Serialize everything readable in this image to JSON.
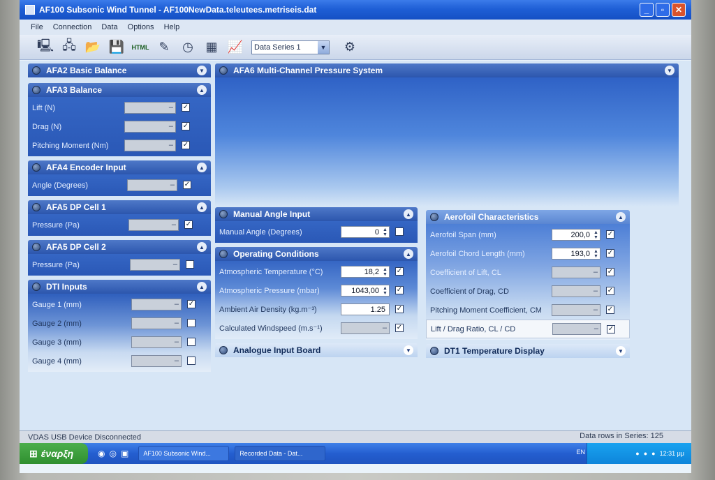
{
  "window": {
    "title": "AF100 Subsonic Wind Tunnel - AF100NewData.teleutees.metriseis.dat"
  },
  "menu": [
    "File",
    "Connection",
    "Data",
    "Options",
    "Help"
  ],
  "toolbar": {
    "icons": [
      "connect-icon",
      "disconnect-icon",
      "open-folder-icon",
      "save-icon",
      "html-icon",
      "pencil-icon",
      "clock-icon",
      "table-icon",
      "chart-icon"
    ],
    "html_label": "HTML",
    "series_select": "Data Series 1"
  },
  "left_panels": {
    "afa2": {
      "title": "AFA2 Basic Balance"
    },
    "afa3": {
      "title": "AFA3 Balance",
      "rows": [
        {
          "label": "Lift  (N)",
          "value": "",
          "checked": true
        },
        {
          "label": "Drag  (N)",
          "value": "",
          "checked": true
        },
        {
          "label": "Pitching Moment  (Nm)",
          "value": "",
          "checked": true
        }
      ]
    },
    "afa4": {
      "title": "AFA4 Encoder Input",
      "rows": [
        {
          "label": "Angle  (Degrees)",
          "value": "",
          "checked": true
        }
      ]
    },
    "afa5_1": {
      "title": "AFA5 DP Cell 1",
      "rows": [
        {
          "label": "Pressure  (Pa)",
          "value": "",
          "checked": true
        }
      ]
    },
    "afa5_2": {
      "title": "AFA5 DP Cell 2",
      "rows": [
        {
          "label": "Pressure  (Pa)",
          "value": "",
          "checked": false
        }
      ]
    },
    "dti": {
      "title": "DTI Inputs",
      "rows": [
        {
          "label": "Gauge 1  (mm)",
          "value": "",
          "checked": true
        },
        {
          "label": "Gauge 2  (mm)",
          "value": "",
          "checked": false
        },
        {
          "label": "Gauge 3  (mm)",
          "value": "",
          "checked": false
        },
        {
          "label": "Gauge 4  (mm)",
          "value": "",
          "checked": false
        }
      ]
    }
  },
  "afa6": {
    "title": "AFA6 Multi-Channel Pressure System"
  },
  "manual_angle": {
    "title": "Manual Angle Input",
    "rows": [
      {
        "label": "Manual Angle  (Degrees)",
        "value": "0",
        "checked": false
      }
    ]
  },
  "operating": {
    "title": "Operating Conditions",
    "rows": [
      {
        "label": "Atmospheric Temperature  (°C)",
        "value": "18,2",
        "checked": true
      },
      {
        "label": "Atmospheric Pressure  (mbar)",
        "value": "1043,00",
        "checked": true
      },
      {
        "label": "Ambient Air Density  (kg.m⁻³)",
        "value": "1.25",
        "checked": true
      },
      {
        "label": "Calculated Windspeed  (m.s⁻¹)",
        "value": "",
        "checked": true
      }
    ]
  },
  "analogue": {
    "title": "Analogue Input Board"
  },
  "aerofoil": {
    "title": "Aerofoil Characteristics",
    "rows": [
      {
        "label": "Aerofoil Span  (mm)",
        "value": "200,0",
        "checked": true
      },
      {
        "label": "Aerofoil Chord Length  (mm)",
        "value": "193,0",
        "checked": true
      },
      {
        "label": "Coefficient of Lift, CL",
        "value": "",
        "checked": true
      },
      {
        "label": "Coefficient of Drag, CD",
        "value": "",
        "checked": true
      },
      {
        "label": "Pitching Moment Coefficient, CM",
        "value": "",
        "checked": true
      },
      {
        "label": "Lift / Drag Ratio, CL / CD",
        "value": "",
        "checked": true
      }
    ]
  },
  "dt1": {
    "title": "DT1 Temperature Display"
  },
  "status": {
    "left": "VDAS USB Device Disconnected",
    "right": "Data rows in Series: 125"
  },
  "taskbar": {
    "start": "έναρξη",
    "tasks": [
      "AF100 Subsonic Wind...",
      "Recorded Data - Dat..."
    ],
    "lang": "EN",
    "clock": "12:31 μμ"
  }
}
